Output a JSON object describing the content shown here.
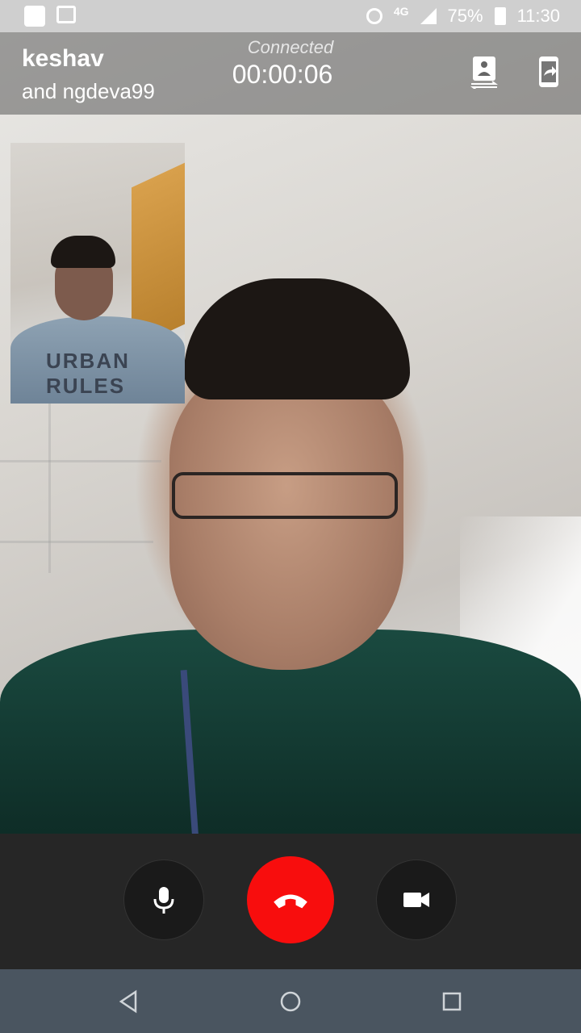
{
  "status_bar": {
    "network": "4G",
    "battery": "75%",
    "time": "11:30"
  },
  "call": {
    "caller_name": "keshav",
    "participants": "and ngdeva99",
    "status": "Connected",
    "timer": "00:00:06"
  },
  "self_view": {
    "shirt_text": "URBAN RULES"
  },
  "colors": {
    "end_call": "#f80d0d",
    "controls_bg": "#262626",
    "nav_bg": "#4a5560"
  },
  "icons": {
    "switch_camera": "switch-camera-icon",
    "share_screen": "share-screen-icon",
    "mic": "microphone-icon",
    "end_call": "phone-hangup-icon",
    "video": "video-camera-icon",
    "back": "back-triangle-icon",
    "home": "home-circle-icon",
    "recents": "recents-square-icon"
  }
}
